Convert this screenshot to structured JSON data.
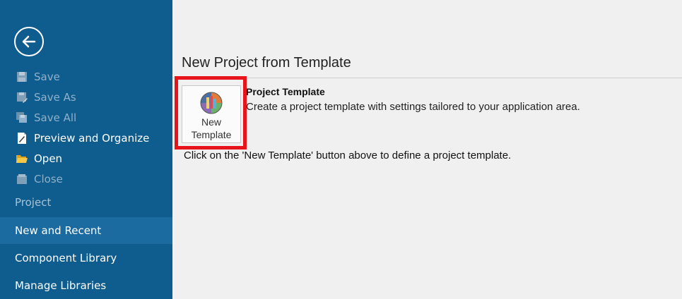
{
  "sidebar": {
    "back_icon": "back-arrow-icon",
    "menu": [
      {
        "label": "Save",
        "icon": "save-icon",
        "enabled": false
      },
      {
        "label": "Save As",
        "icon": "save-as-icon",
        "enabled": false
      },
      {
        "label": "Save All",
        "icon": "save-all-icon",
        "enabled": false
      },
      {
        "label": "Preview and Organize",
        "icon": "preview-organize-icon",
        "enabled": true
      },
      {
        "label": "Open",
        "icon": "open-folder-icon",
        "enabled": true
      },
      {
        "label": "Close",
        "icon": "close-project-icon",
        "enabled": false
      }
    ],
    "section_label": "Project",
    "nav": [
      {
        "label": "New and Recent",
        "selected": true
      },
      {
        "label": "Component Library",
        "selected": false
      },
      {
        "label": "Manage Libraries",
        "selected": false
      }
    ],
    "colors": {
      "background": "#0f5c8e",
      "selected": "#1b6aa0",
      "disabled_text": "#8fb1c9"
    }
  },
  "main": {
    "title": "New Project from Template",
    "template_button": {
      "label_line1": "New",
      "label_line2": "Template",
      "icon": "project-template-icon"
    },
    "description_title": "Project Template",
    "description_text": "Create a project template with settings tailored to your application area.",
    "instruction": "Click on the 'New Template' button above to define a project template.",
    "highlight_color": "#e8141c"
  }
}
